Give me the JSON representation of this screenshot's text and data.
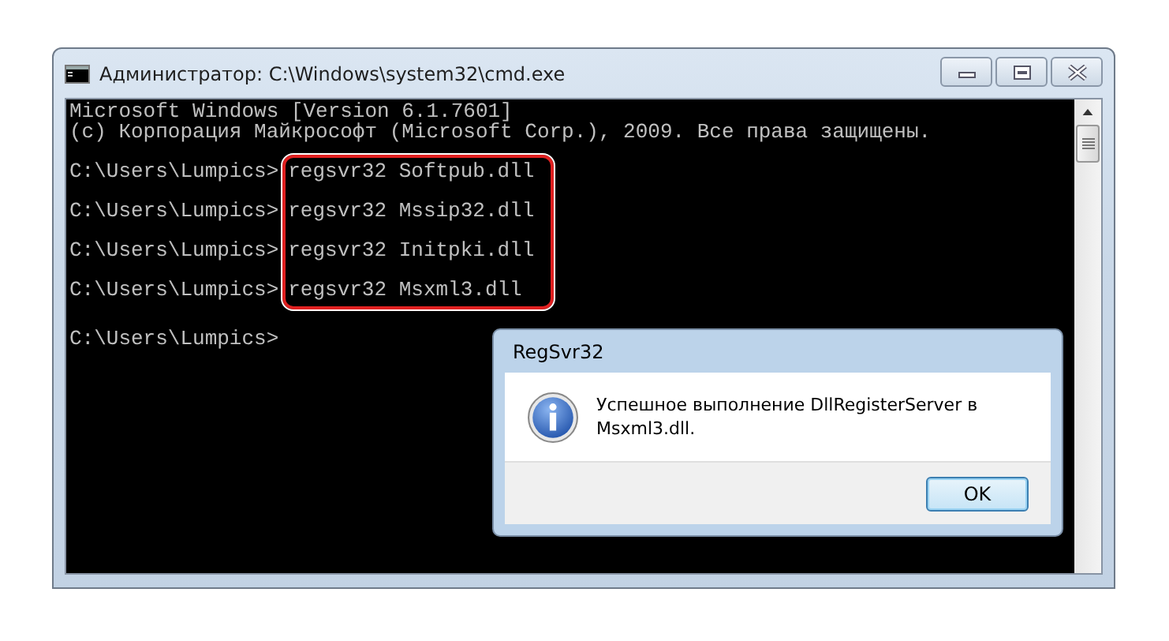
{
  "window": {
    "title": "Администратор: C:\\Windows\\system32\\cmd.exe"
  },
  "console": {
    "header": [
      "Microsoft Windows [Version 6.1.7601]",
      "(c) Корпорация Майкрософт (Microsoft Corp.), 2009. Все права защищены."
    ],
    "entries": [
      {
        "prompt": "C:\\Users\\Lumpics>",
        "command": "regsvr32 Softpub.dll",
        "highlighted": true
      },
      {
        "prompt": "C:\\Users\\Lumpics>",
        "command": "regsvr32 Mssip32.dll",
        "highlighted": true
      },
      {
        "prompt": "C:\\Users\\Lumpics>",
        "command": "regsvr32 Initpki.dll",
        "highlighted": true
      },
      {
        "prompt": "C:\\Users\\Lumpics>",
        "command": "regsvr32 Msxml3.dll",
        "highlighted": true
      },
      {
        "prompt": "C:\\Users\\Lumpics>",
        "highlighted": false
      }
    ]
  },
  "dialog": {
    "title": "RegSvr32",
    "message": "Успешное выполнение DllRegisterServer в Msxml3.dll.",
    "buttons": [
      "OK"
    ]
  }
}
